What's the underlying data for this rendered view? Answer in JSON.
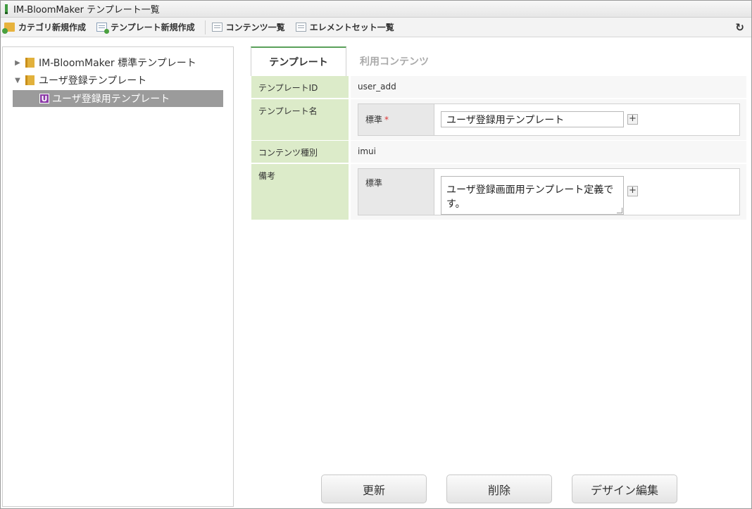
{
  "window": {
    "title": "IM-BloomMaker テンプレート一覧"
  },
  "toolbar": {
    "items": [
      {
        "label": "カテゴリ新規作成",
        "icon": "folder-add-icon"
      },
      {
        "label": "テンプレート新規作成",
        "icon": "document-add-icon"
      },
      {
        "label": "コンテンツ一覧",
        "icon": "list-icon"
      },
      {
        "label": "エレメントセット一覧",
        "icon": "list-icon"
      }
    ],
    "refresh_icon": "refresh-icon"
  },
  "tree": {
    "items": [
      {
        "label": "IM-BloomMaker 標準テンプレート",
        "expanded": false
      },
      {
        "label": "ユーザ登録テンプレート",
        "expanded": true
      },
      {
        "label": "ユーザ登録用テンプレート",
        "badge": "U",
        "selected": true
      }
    ]
  },
  "tabs": [
    {
      "label": "テンプレート",
      "active": true
    },
    {
      "label": "利用コンテンツ",
      "active": false
    }
  ],
  "form": {
    "template_id": {
      "label": "テンプレートID",
      "value": "user_add"
    },
    "template_name": {
      "label": "テンプレート名",
      "locale_label": "標準",
      "required_mark": "*",
      "value": "ユーザ登録用テンプレート"
    },
    "content_type": {
      "label": "コンテンツ種別",
      "value": "imui"
    },
    "note": {
      "label": "備考",
      "locale_label": "標準",
      "value": "ユーザ登録画面用テンプレート定義です。"
    },
    "add_symbol": "+"
  },
  "actions": {
    "update": "更新",
    "delete": "削除",
    "design_edit": "デザイン編集"
  },
  "colors": {
    "label_bg": "#dcebc9",
    "tab_accent": "#5aa05a",
    "selected_row": "#9b9b9b",
    "badge": "#8b3aa7"
  }
}
